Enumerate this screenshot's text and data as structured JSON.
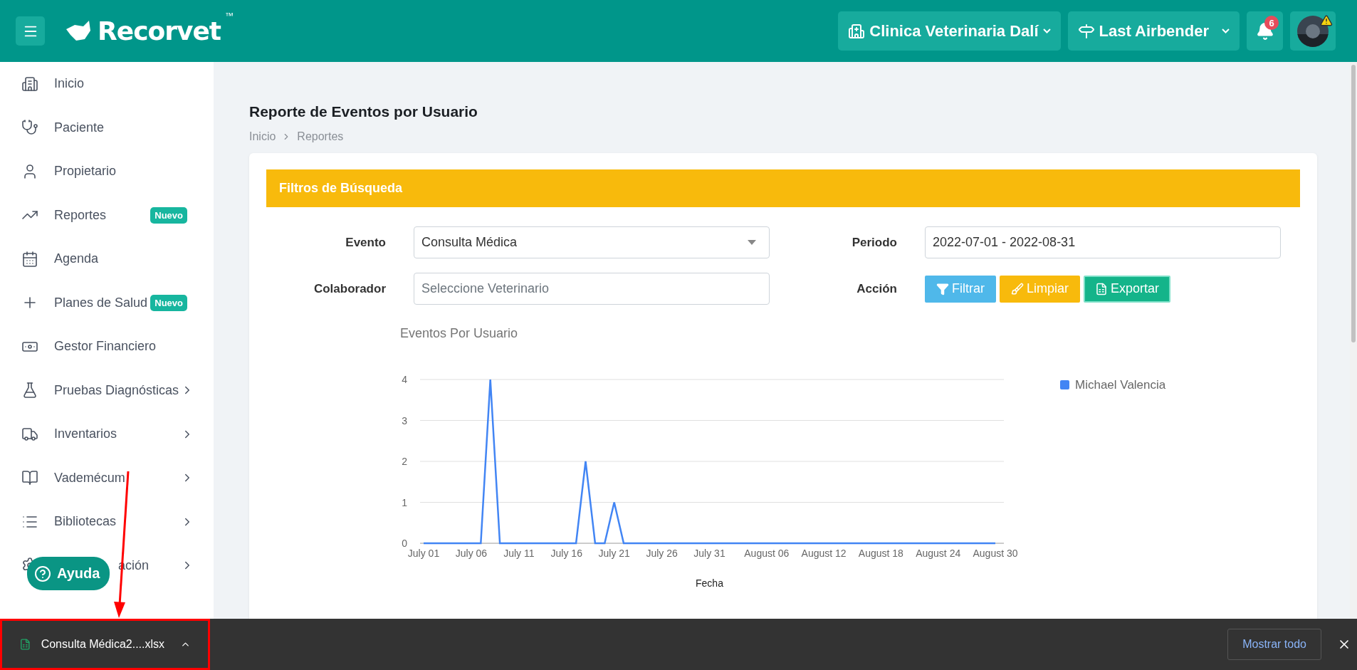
{
  "header": {
    "logo": "Recorvet",
    "trademark": "™",
    "clinic": "Clinica Veterinaria Dalí",
    "user": "Last Airbender",
    "notifications": "6"
  },
  "sidebar": {
    "items": [
      {
        "label": "Inicio",
        "expandable": false
      },
      {
        "label": "Paciente",
        "expandable": false
      },
      {
        "label": "Propietario",
        "expandable": false
      },
      {
        "label": "Reportes",
        "badge": "Nuevo",
        "expandable": false
      },
      {
        "label": "Agenda",
        "expandable": false
      },
      {
        "label": "Planes de Salud",
        "badge": "Nuevo",
        "expandable": false
      },
      {
        "label": "Gestor Financiero",
        "expandable": false
      },
      {
        "label": "Pruebas Diagnósticas",
        "expandable": true
      },
      {
        "label": "Inventarios",
        "expandable": true
      },
      {
        "label": "Vademécum",
        "expandable": true
      },
      {
        "label": "Bibliotecas",
        "expandable": true
      },
      {
        "label": "ación",
        "expandable": true,
        "covered": true
      }
    ]
  },
  "help_button": "Ayuda",
  "page": {
    "title": "Reporte de Eventos por Usuario",
    "breadcrumb": [
      "Inicio",
      "Reportes"
    ]
  },
  "filters": {
    "title": "Filtros de Búsqueda",
    "fields": [
      {
        "label": "Evento",
        "kind": "select",
        "value": "Consulta Médica"
      },
      {
        "label": "Periodo",
        "kind": "text",
        "value": "2022-07-01 - 2022-08-31"
      },
      {
        "label": "Colaborador",
        "kind": "text",
        "placeholder": "Seleccione Veterinario"
      },
      {
        "label": "Acción",
        "kind": "actions"
      }
    ],
    "buttons": [
      {
        "label": "Filtrar",
        "kind": "filter"
      },
      {
        "label": "Limpiar",
        "kind": "clear"
      },
      {
        "label": "Exportar",
        "kind": "export"
      }
    ]
  },
  "chart": {
    "chart_data": {
      "type": "line",
      "title": "Eventos Por Usuario",
      "xlabel": "Fecha",
      "categories": [
        "July 01",
        null,
        null,
        null,
        null,
        "July 06",
        null,
        null,
        null,
        null,
        "July 11",
        null,
        null,
        null,
        null,
        "July 16",
        null,
        null,
        null,
        null,
        "July 21",
        null,
        null,
        null,
        null,
        "July 26",
        null,
        null,
        null,
        null,
        "July 31",
        null,
        null,
        null,
        null,
        null,
        "August 06",
        null,
        null,
        null,
        null,
        null,
        "August 12",
        null,
        null,
        null,
        null,
        null,
        "August 18",
        null,
        null,
        null,
        null,
        null,
        "August 24",
        null,
        null,
        null,
        null,
        null,
        "August 30"
      ],
      "series": [
        {
          "name": "Michael Valencia",
          "color": "#4285f4",
          "values": [
            0,
            0,
            0,
            0,
            0,
            0,
            0,
            4,
            0,
            0,
            0,
            0,
            0,
            0,
            0,
            0,
            0,
            2,
            0,
            0,
            1,
            0,
            0,
            0,
            0,
            0,
            0,
            0,
            0,
            0,
            0,
            0,
            0,
            0,
            0,
            0,
            0,
            0,
            0,
            0,
            0,
            0,
            0,
            0,
            0,
            0,
            0,
            0,
            0,
            0,
            0,
            0,
            0,
            0,
            0,
            0,
            0,
            0,
            0,
            0,
            0
          ]
        }
      ],
      "ylim": [
        0,
        4
      ],
      "yticks": [
        0,
        1,
        2,
        3,
        4
      ],
      "grid": true
    }
  },
  "download_bar": {
    "file": "Consulta Médica2....xlsx",
    "show_all": "Mostrar todo"
  }
}
